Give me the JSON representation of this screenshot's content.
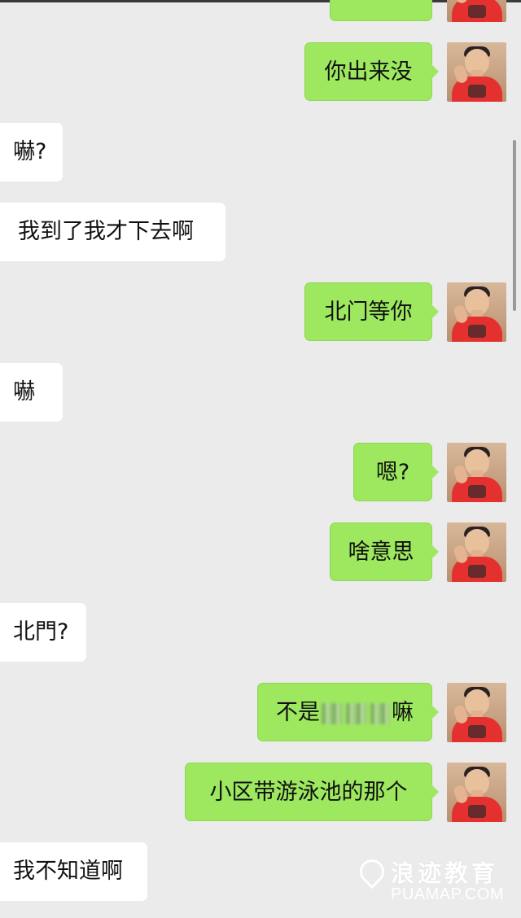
{
  "messages": [
    {
      "side": "me",
      "text": "",
      "partial": true
    },
    {
      "side": "me",
      "text": "你出来没"
    },
    {
      "side": "them",
      "text": "嚇?"
    },
    {
      "side": "them",
      "text": "我到了我才下去啊"
    },
    {
      "side": "me",
      "text": "北门等你"
    },
    {
      "side": "them",
      "text": "嚇"
    },
    {
      "side": "me",
      "text": "嗯?"
    },
    {
      "side": "me",
      "text": "啥意思"
    },
    {
      "side": "them",
      "text": "北門?"
    },
    {
      "side": "me",
      "text_before": "不是",
      "text_after": "嘛",
      "redacted": true
    },
    {
      "side": "me",
      "text": "小区带游泳池的那个"
    },
    {
      "side": "them",
      "text": "我不知道啊"
    }
  ],
  "watermark": {
    "title": "浪迹教育",
    "subtitle": "PUAMAP.COM"
  },
  "colors": {
    "sent_bubble": "#9de85e",
    "received_bubble": "#ffffff",
    "background": "#ebebeb"
  }
}
